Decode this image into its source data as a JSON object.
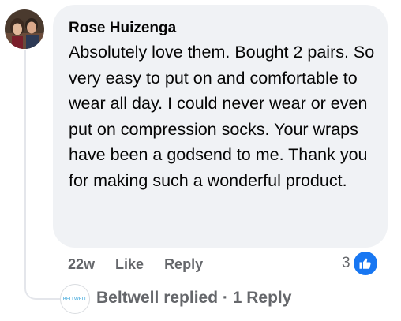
{
  "comment": {
    "author": "Rose Huizenga",
    "text": "Absolutely love them. Bought 2 pairs. So very easy to put on and comfortable to wear all day. I could never wear or even put on compression socks. Your wraps have been a godsend to me. Thank you for making such a wonderful product.",
    "time": "22w",
    "like_label": "Like",
    "reply_label": "Reply",
    "reaction_count": "3",
    "reaction_icon": "thumbs-up-icon"
  },
  "reply_summary": {
    "page_logo_text": "BELTWELL",
    "text": "Beltwell replied · 1 Reply"
  },
  "colors": {
    "bubble_bg": "#f0f2f5",
    "secondary_text": "#65676b",
    "like_blue": "#1877f2",
    "logo_blue": "#2fa0d8"
  }
}
